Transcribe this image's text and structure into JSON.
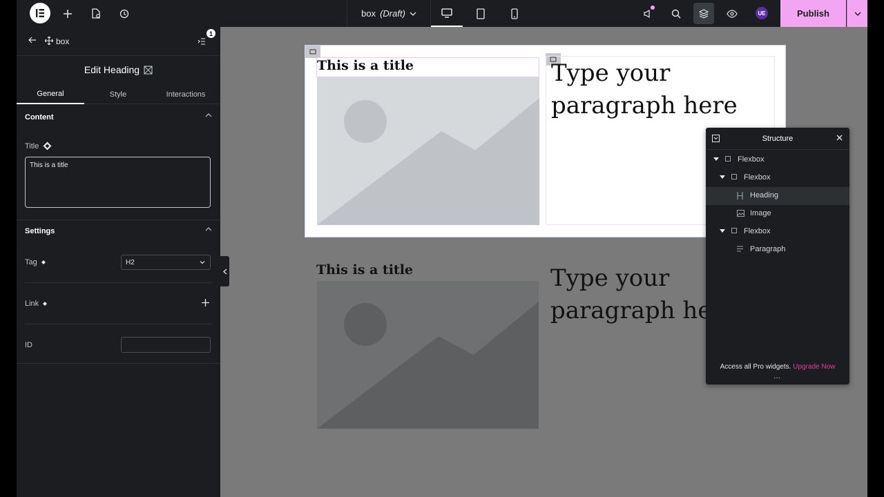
{
  "topbar": {
    "doc_title": "box",
    "doc_status": "(Draft)",
    "publish_label": "Publish",
    "avatar_initials": "UE",
    "accent_color": "#f2a5f0"
  },
  "panel": {
    "breadcrumb": "box",
    "notification_count": "1",
    "edit_title": "Edit Heading",
    "tabs": [
      "General",
      "Style",
      "Interactions"
    ],
    "content_section": "Content",
    "title_label": "Title",
    "title_value": "This is a title",
    "settings_section": "Settings",
    "tag_label": "Tag",
    "tag_value": "H2",
    "link_label": "Link",
    "id_label": "ID",
    "id_value": ""
  },
  "canvas": {
    "heading": "This is a title",
    "paragraph_line1": "Type your",
    "paragraph_line2": "paragraph here",
    "paragraph_line2_clipped": "paragraph he"
  },
  "structure": {
    "title": "Structure",
    "items": [
      {
        "label": "Flexbox",
        "icon": "box-icon"
      },
      {
        "label": "Flexbox",
        "icon": "box-icon"
      },
      {
        "label": "Heading",
        "icon": "heading-icon"
      },
      {
        "label": "Image",
        "icon": "image-icon"
      },
      {
        "label": "Flexbox",
        "icon": "box-icon"
      },
      {
        "label": "Paragraph",
        "icon": "paragraph-icon"
      }
    ],
    "pro_text": "Access all Pro widgets.",
    "upgrade_label": "Upgrade Now"
  }
}
